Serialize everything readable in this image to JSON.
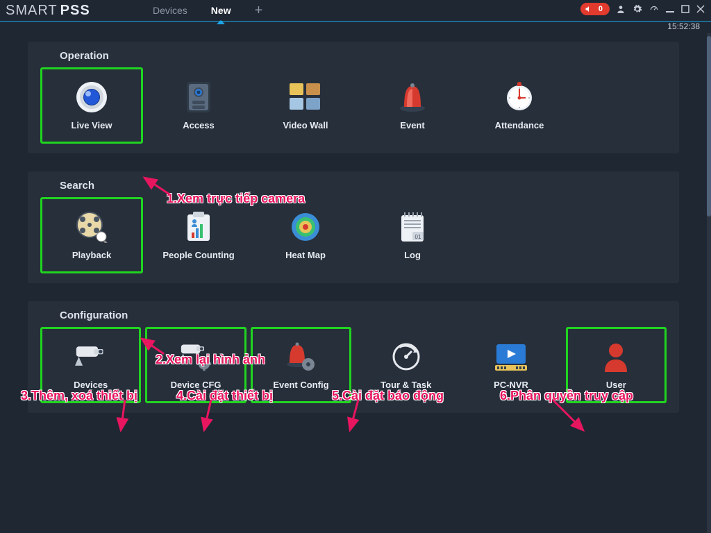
{
  "app": {
    "name_a": "SMART",
    "name_b": "PSS"
  },
  "tabs": {
    "devices": "Devices",
    "new": "New"
  },
  "header": {
    "alert_count": "0",
    "time": "15:52:38"
  },
  "sections": {
    "operation": {
      "title": "Operation",
      "items": [
        {
          "label": "Live View"
        },
        {
          "label": "Access"
        },
        {
          "label": "Video Wall"
        },
        {
          "label": "Event"
        },
        {
          "label": "Attendance"
        }
      ]
    },
    "search": {
      "title": "Search",
      "items": [
        {
          "label": "Playback"
        },
        {
          "label": "People Counting"
        },
        {
          "label": "Heat Map"
        },
        {
          "label": "Log"
        }
      ]
    },
    "configuration": {
      "title": "Configuration",
      "items": [
        {
          "label": "Devices"
        },
        {
          "label": "Device CFG"
        },
        {
          "label": "Event Config"
        },
        {
          "label": "Tour & Task"
        },
        {
          "label": "PC-NVR"
        },
        {
          "label": "User"
        }
      ]
    }
  },
  "annotations": {
    "a1": "1.Xem trực tiếp camera",
    "a2": "2.Xem lại hình ảnh",
    "a3": "3.Thêm, xoá thiết bị",
    "a4": "4.Cài đặt thiết bị",
    "a5": "5.Cài đặt báo động",
    "a6": "6.Phân quyền truy cập"
  }
}
